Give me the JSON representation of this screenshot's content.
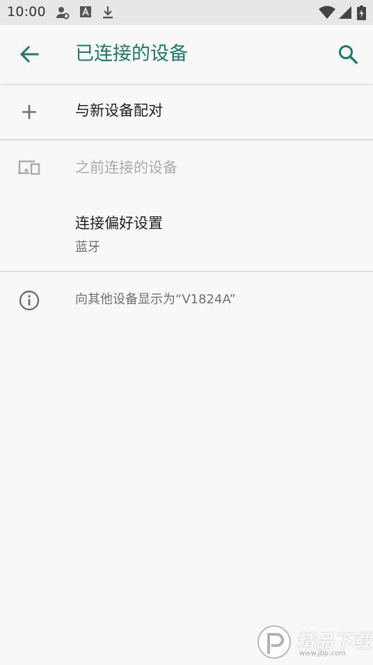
{
  "status_bar": {
    "time": "10:00",
    "icons": [
      "person-settings-icon",
      "font-a-icon",
      "download-icon",
      "wifi-icon",
      "cell-signal-icon",
      "battery-charging-icon"
    ]
  },
  "app_bar": {
    "title": "已连接的设备",
    "back_icon": "arrow-back-icon",
    "search_icon": "search-icon",
    "accent_color": "#1a7a6e"
  },
  "items": {
    "pair_new": {
      "label": "与新设备配对",
      "icon": "plus-icon"
    },
    "previously_connected": {
      "label": "之前连接的设备",
      "icon": "devices-icon"
    },
    "connection_prefs": {
      "title": "连接偏好设置",
      "summary": "蓝牙"
    },
    "visible_as": {
      "label": "向其他设备显示为“V1824A”",
      "icon": "info-icon"
    }
  },
  "watermark": {
    "text": "精品下载",
    "url": "www.jbp.com"
  }
}
